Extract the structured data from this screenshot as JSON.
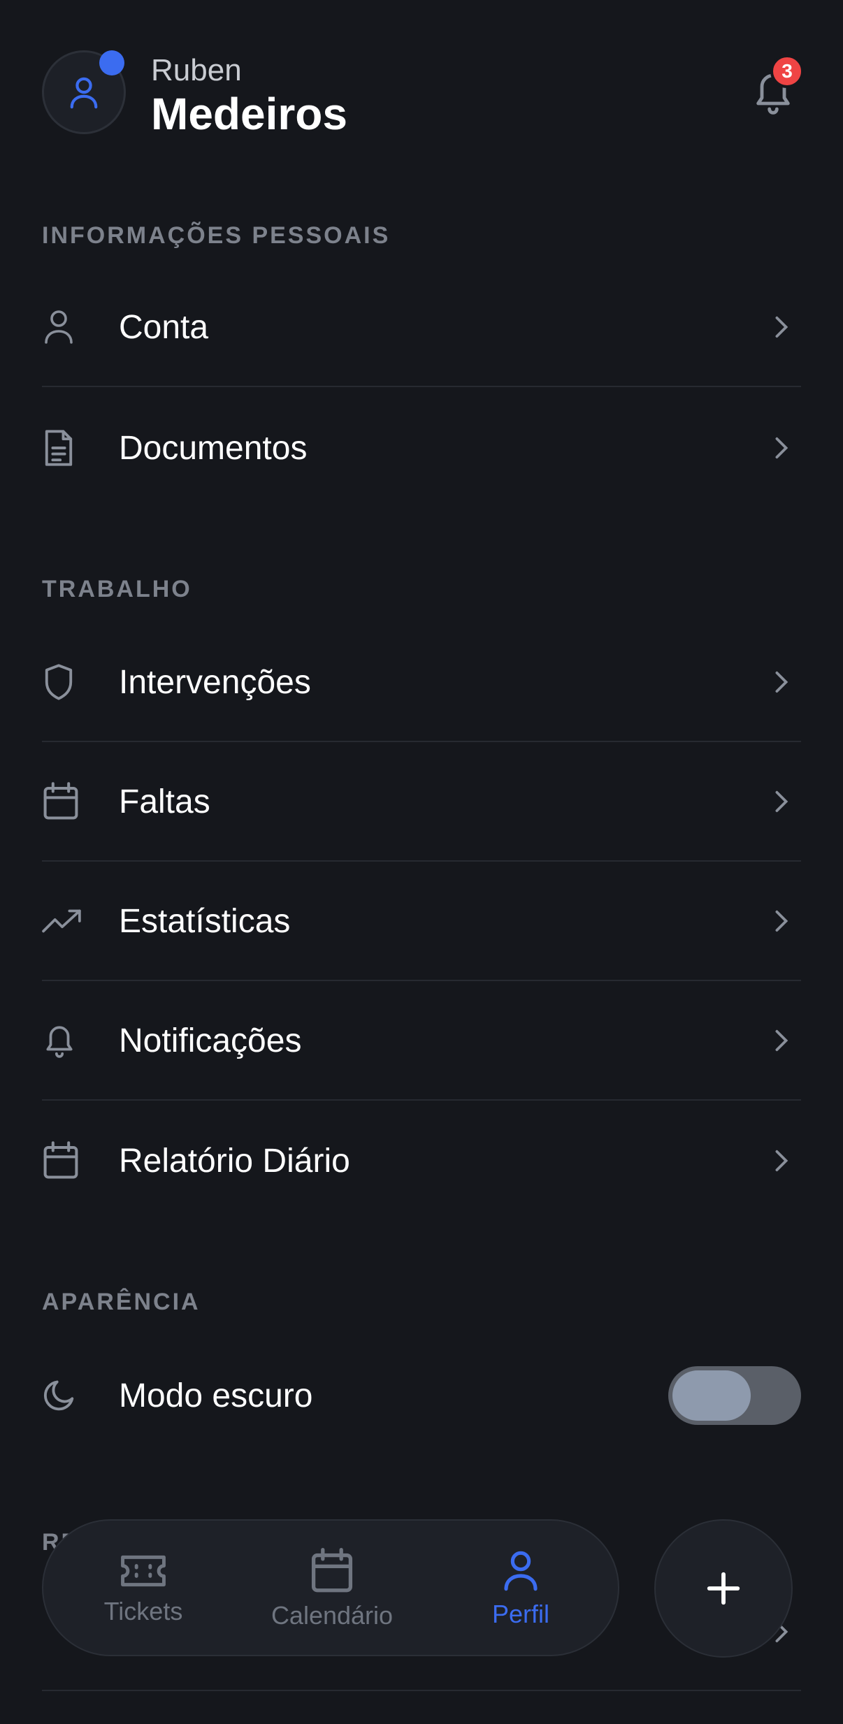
{
  "header": {
    "first_name": "Ruben",
    "last_name": "Medeiros",
    "notification_count": "3"
  },
  "sections": {
    "personal": {
      "title": "INFORMAÇÕES PESSOAIS",
      "items": [
        {
          "label": "Conta",
          "icon": "user-icon"
        },
        {
          "label": "Documentos",
          "icon": "document-icon"
        }
      ]
    },
    "work": {
      "title": "TRABALHO",
      "items": [
        {
          "label": "Intervenções",
          "icon": "shield-icon"
        },
        {
          "label": "Faltas",
          "icon": "calendar-icon"
        },
        {
          "label": "Estatísticas",
          "icon": "trending-up-icon"
        },
        {
          "label": "Notificações",
          "icon": "bell-icon"
        },
        {
          "label": "Relatório Diário",
          "icon": "calendar-icon"
        }
      ]
    },
    "appearance": {
      "title": "APARÊNCIA",
      "dark_mode_label": "Modo escuro",
      "dark_mode_on": false
    },
    "partial": {
      "title_visible": "RE"
    }
  },
  "nav": {
    "tickets": "Tickets",
    "calendar": "Calendário",
    "profile": "Perfil",
    "active": "profile"
  },
  "colors": {
    "background": "#15171c",
    "accent": "#3b6cf0",
    "badge": "#ef4444",
    "muted": "#7d828c"
  }
}
